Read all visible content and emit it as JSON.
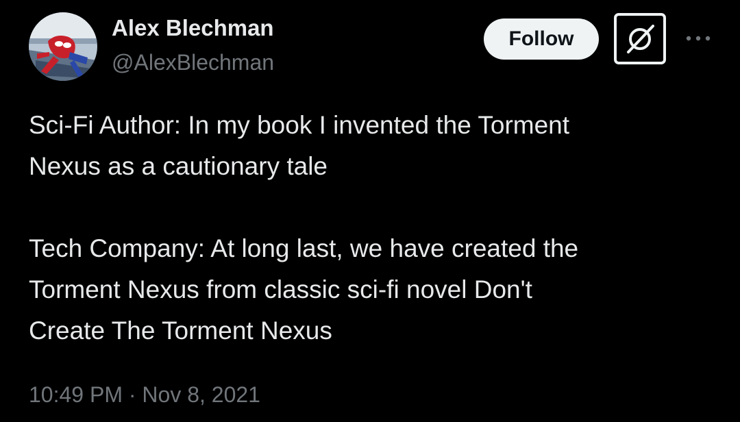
{
  "author": {
    "display_name": "Alex Blechman",
    "handle": "@AlexBlechman",
    "avatar_icon": "spiderman-avatar"
  },
  "actions": {
    "follow_label": "Follow",
    "grok_icon": "grok-icon",
    "more_icon": "more-dots-icon"
  },
  "tweet": {
    "lines": [
      "Sci-Fi Author: In my book I invented the Torment",
      "Nexus as a cautionary tale",
      "",
      "Tech Company: At long last, we have created the",
      "Torment Nexus from classic sci-fi novel Don't",
      "Create The Torment Nexus"
    ],
    "time": "10:49 PM",
    "separator": "·",
    "date": "Nov 8, 2021"
  },
  "colors": {
    "background": "#000000",
    "primary_text": "#e7e9ea",
    "secondary_text": "#71767b",
    "follow_bg": "#eff3f4",
    "follow_text": "#0f1419"
  }
}
